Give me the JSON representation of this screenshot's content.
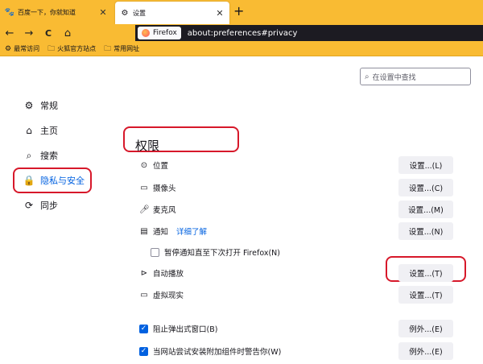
{
  "tabs": [
    {
      "title": "百度一下，你就知道",
      "icon": "paw-icon"
    },
    {
      "title": "设置",
      "icon": "gear-icon"
    }
  ],
  "toolbar": {
    "back": "←",
    "forward": "→",
    "reload": "C",
    "home": "⌂",
    "identity_label": "Firefox",
    "url": "about:preferences#privacy"
  },
  "bookmarks": [
    "最常访问",
    "火狐官方站点",
    "常用网址"
  ],
  "search": {
    "placeholder": "在设置中查找"
  },
  "sidebar": {
    "items": [
      {
        "label": "常规",
        "icon": "gear-icon",
        "active": false
      },
      {
        "label": "主页",
        "icon": "home-icon",
        "active": false
      },
      {
        "label": "搜索",
        "icon": "search-icon",
        "active": false
      },
      {
        "label": "隐私与安全",
        "icon": "lock-icon",
        "active": true
      },
      {
        "label": "同步",
        "icon": "sync-icon",
        "active": false
      }
    ]
  },
  "permissions": {
    "heading": "权限",
    "rows": [
      {
        "label": "位置",
        "button": "设置...(L)"
      },
      {
        "label": "摄像头",
        "button": "设置...(C)"
      },
      {
        "label": "麦克风",
        "button": "设置...(M)"
      },
      {
        "label": "通知",
        "link": "详细了解",
        "button": "设置...(N)"
      },
      {
        "label": "暂停通知直至下次打开 Firefox(N)"
      },
      {
        "label": "自动播放",
        "button": "设置...(T)"
      },
      {
        "label": "虚拟现实",
        "button": "设置...(T)"
      },
      {
        "label": "阻止弹出式窗口(B)",
        "button": "例外...(E)"
      },
      {
        "label": "当网站尝试安装附加组件时警告你(W)",
        "button": "例外...(E)"
      }
    ]
  },
  "colors": {
    "accent": "#0061e0",
    "toolbar": "#f9bb33",
    "highlight": "#d7182a"
  }
}
